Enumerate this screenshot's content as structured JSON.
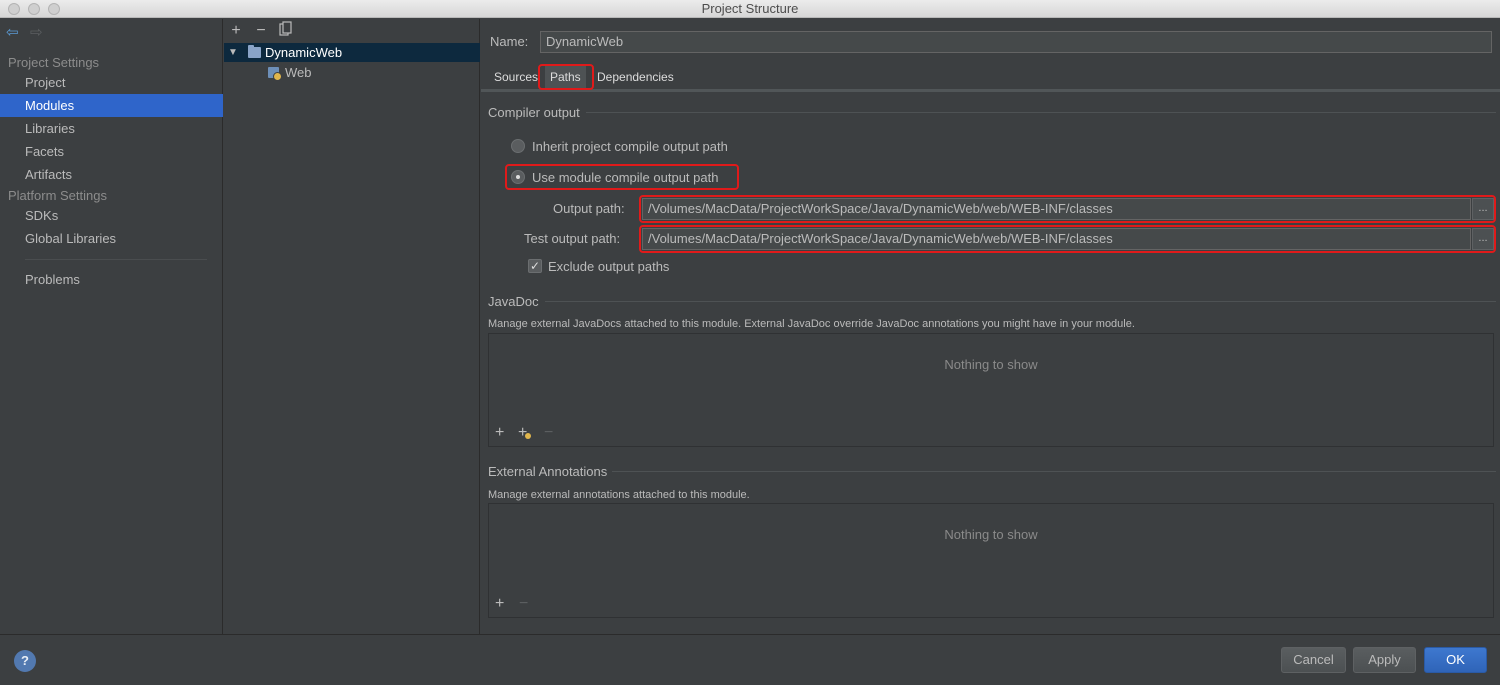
{
  "window": {
    "title": "Project Structure"
  },
  "nav": {
    "back_icon": "back-arrow-icon",
    "forward_icon": "forward-arrow-icon",
    "project_settings_header": "Project Settings",
    "project_items": [
      "Project",
      "Modules",
      "Libraries",
      "Facets",
      "Artifacts"
    ],
    "platform_settings_header": "Platform Settings",
    "platform_items": [
      "SDKs",
      "Global Libraries"
    ],
    "problems": "Problems",
    "selected": "Modules"
  },
  "tree": {
    "toolbar": {
      "add": "+",
      "remove": "−",
      "copy_icon": "copy-icon"
    },
    "root": "DynamicWeb",
    "child": "Web"
  },
  "module": {
    "name_label": "Name:",
    "name_value": "DynamicWeb",
    "tabs": [
      "Sources",
      "Paths",
      "Dependencies"
    ],
    "active_tab": "Paths"
  },
  "compiler_output": {
    "title": "Compiler output",
    "inherit_option": "Inherit project compile output path",
    "use_module_option": "Use module compile output path",
    "selected_option": "use_module",
    "output_path_label": "Output path:",
    "output_path_value": "/Volumes/MacData/ProjectWorkSpace/Java/DynamicWeb/web/WEB-INF/classes",
    "test_output_path_label": "Test output path:",
    "test_output_path_value": "/Volumes/MacData/ProjectWorkSpace/Java/DynamicWeb/web/WEB-INF/classes",
    "browse": "...",
    "exclude_label": "Exclude output paths",
    "exclude_checked": true
  },
  "javadoc": {
    "title": "JavaDoc",
    "description": "Manage external JavaDocs attached to this module. External JavaDoc override JavaDoc annotations you might have in your module.",
    "empty": "Nothing to show",
    "add": "+",
    "add_url": "+",
    "remove": "−"
  },
  "external_annotations": {
    "title": "External Annotations",
    "description": "Manage external annotations attached to this module.",
    "empty": "Nothing to show",
    "add": "+",
    "remove": "−"
  },
  "footer": {
    "help": "?",
    "cancel": "Cancel",
    "apply": "Apply",
    "ok": "OK"
  },
  "colors": {
    "background": "#3c3f41",
    "selection": "#2f65ca",
    "highlight": "#e01a1a",
    "primary_button": "#2f64b8"
  }
}
